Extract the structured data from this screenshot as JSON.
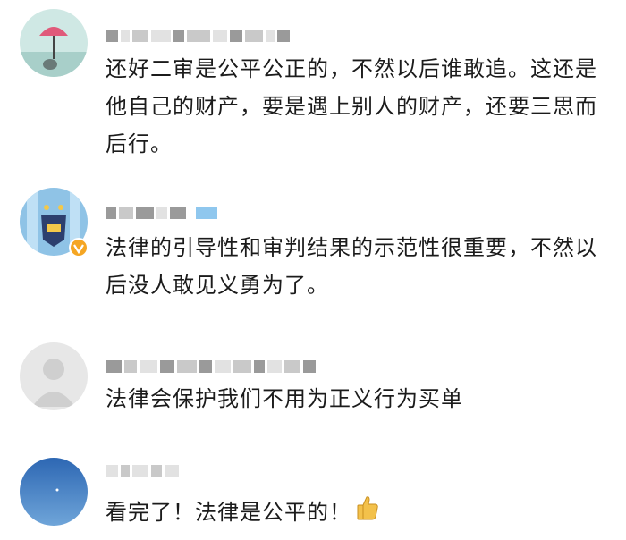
{
  "comments": [
    {
      "text": "还好二审是公平公正的，不然以后谁敢追。这还是他自己的财产，要是遇上别人的财产，还要三思而后行。"
    },
    {
      "text": "法律的引导性和审判结果的示范性很重要，不然以后没人敢见义勇为了。",
      "verified": true
    },
    {
      "text": "法律会保护我们不用为正义行为买单"
    },
    {
      "text": "看完了！法律是公平的！",
      "emoji": "thumbs-up-icon"
    }
  ],
  "colors": {
    "text": "#1b1b1b",
    "badge": "#f5a623",
    "pixelated": "#c9c9c9"
  }
}
